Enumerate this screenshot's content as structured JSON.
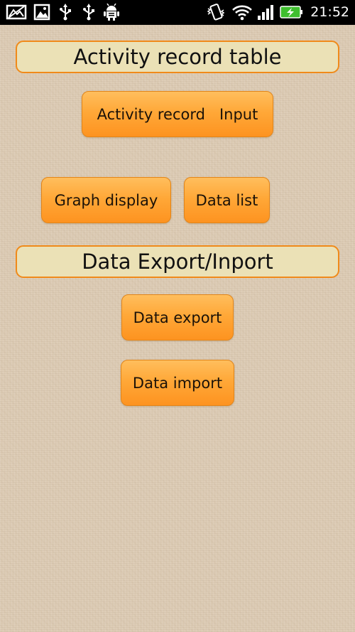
{
  "status_bar": {
    "time": "21:52",
    "icons": [
      "picture-frame-icon",
      "gallery-icon",
      "usb-icon",
      "usb-icon",
      "android-debug-icon",
      "vibrate-icon",
      "wifi-icon",
      "signal-icon",
      "battery-charging-icon"
    ],
    "accent": "#3fbf2f"
  },
  "sections": {
    "activity": {
      "title": "Activity record table"
    },
    "data": {
      "title": "Data Export/Inport"
    }
  },
  "buttons": {
    "activity_input": "Activity record   Input",
    "graph_display": "Graph display",
    "data_list": "Data list",
    "data_export": "Data export",
    "data_import": "Data import"
  },
  "colors": {
    "button_top": "#ffbe5d",
    "button_bottom": "#fd9320",
    "button_border": "#e1851a",
    "header_fill": "#ebe1b6",
    "header_border": "#f08a1a",
    "background": "#dccbb4"
  }
}
